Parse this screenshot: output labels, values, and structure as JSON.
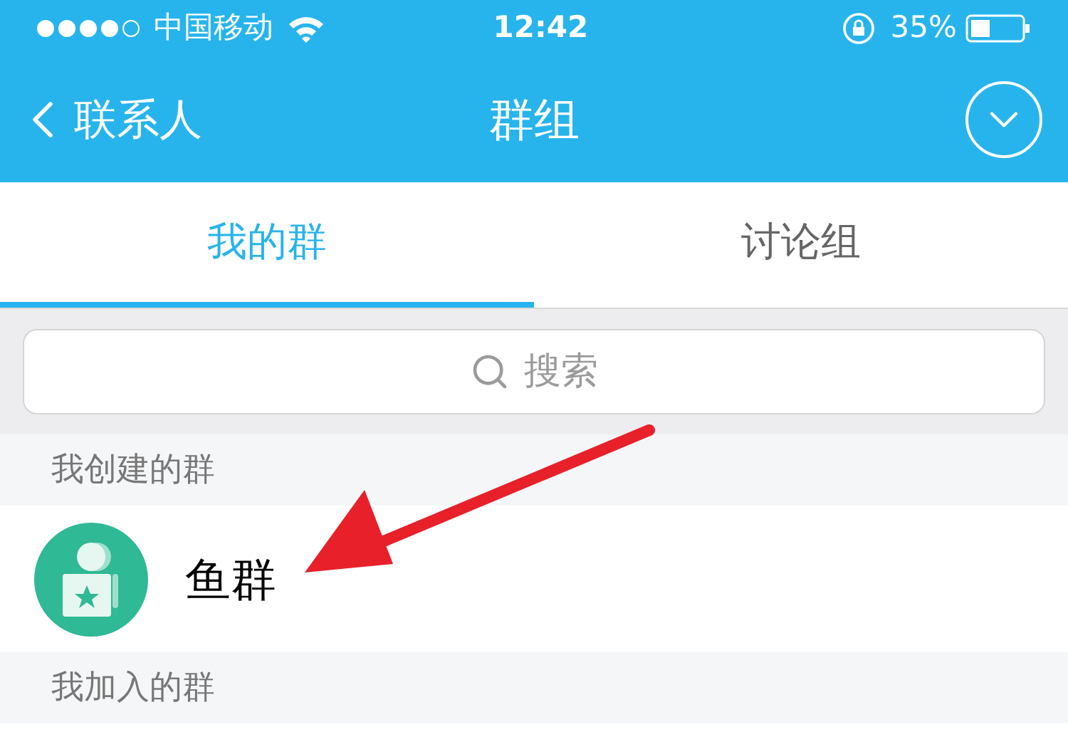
{
  "status_bar": {
    "carrier": "中国移动",
    "time": "12:42",
    "battery": "35%"
  },
  "nav": {
    "back_label": "联系人",
    "title": "群组"
  },
  "tabs": [
    {
      "label": "我的群",
      "selected": true
    },
    {
      "label": "讨论组",
      "selected": false
    }
  ],
  "search": {
    "placeholder": "搜索"
  },
  "sections": [
    {
      "title": "我创建的群",
      "groups": [
        {
          "name": "鱼群"
        }
      ]
    },
    {
      "title": "我加入的群"
    }
  ]
}
